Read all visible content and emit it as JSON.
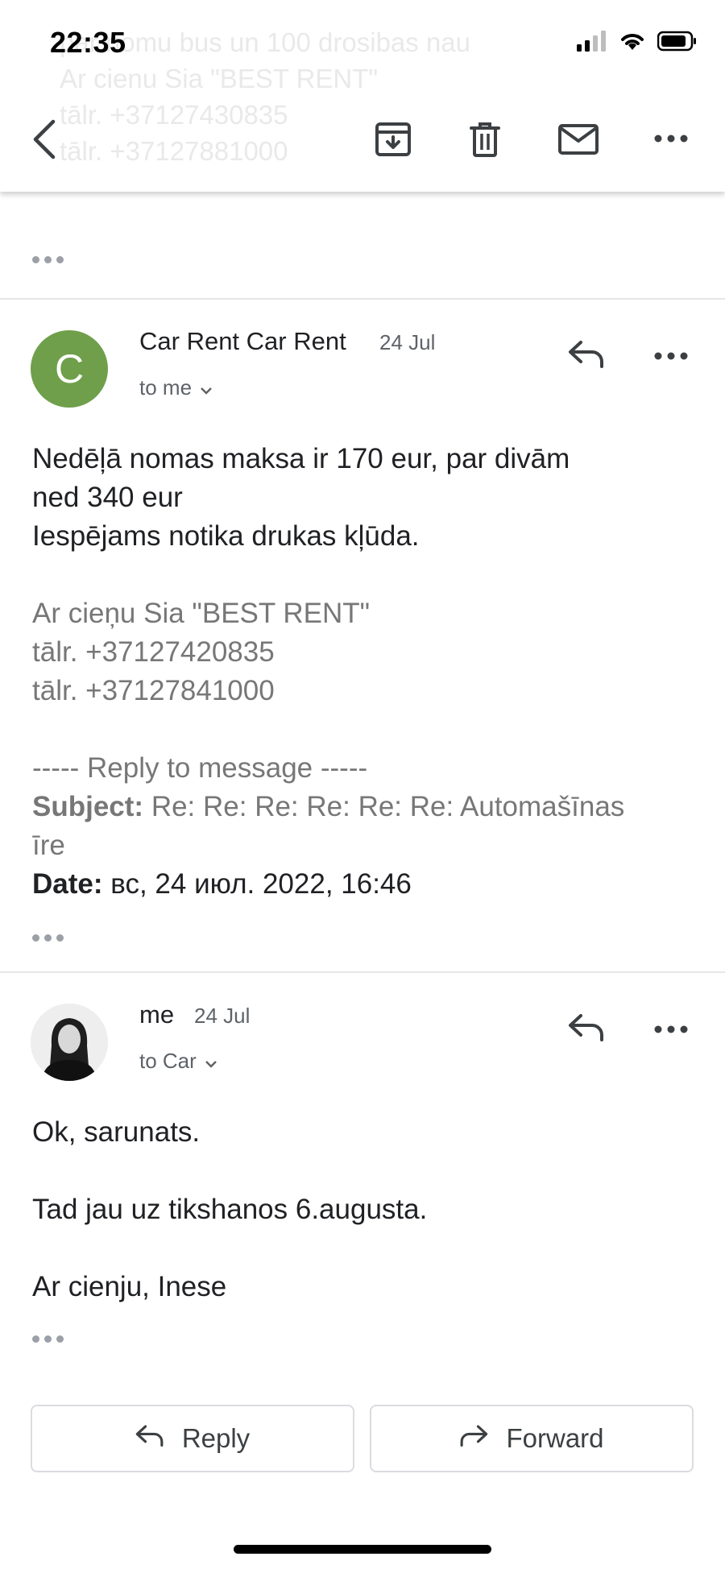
{
  "status_bar": {
    "time": "22:35"
  },
  "ghost_text": [
    "par nomu bus un 100 drosibas nau",
    "Ar cienu Sia \"BEST RENT\"",
    "tālr. +37127430835",
    "tālr. +37127881000"
  ],
  "toolbar": {
    "back_icon": "chevron-left-icon",
    "archive_icon": "archive-icon",
    "delete_icon": "trash-icon",
    "mark_unread_icon": "mail-icon",
    "more_icon": "more-horizontal-icon"
  },
  "messages": [
    {
      "avatar_letter": "C",
      "avatar_color": "#6f9f4a",
      "sender": "Car Rent Car Rent",
      "date": "24 Jul",
      "recipient": "to me",
      "body_lines": [
        "Nedēļā nomas maksa ir 170 eur, par divām",
        "ned 340 eur",
        "Iespējams notika drukas kļūda."
      ],
      "signature": [
        "Ar cieņu Sia \"BEST RENT\"",
        "tālr. +37127420835",
        "tālr. +37127841000"
      ],
      "quote_header": "----- Reply to message -----",
      "subject_label": "Subject:",
      "subject_value": "Re: Re: Re: Re: Re: Re: Automašīnas",
      "subject_value_cont": "īre",
      "date_label": "Date:",
      "date_value": "вс, 24 июл. 2022, 16:46"
    },
    {
      "sender": "me",
      "date": "24 Jul",
      "recipient": "to Car",
      "body_lines": [
        "Ok, sarunats.",
        "Tad jau uz tikshanos 6.augusta.",
        "Ar cienju, Inese"
      ]
    }
  ],
  "actions": {
    "reply": "Reply",
    "forward": "Forward"
  }
}
